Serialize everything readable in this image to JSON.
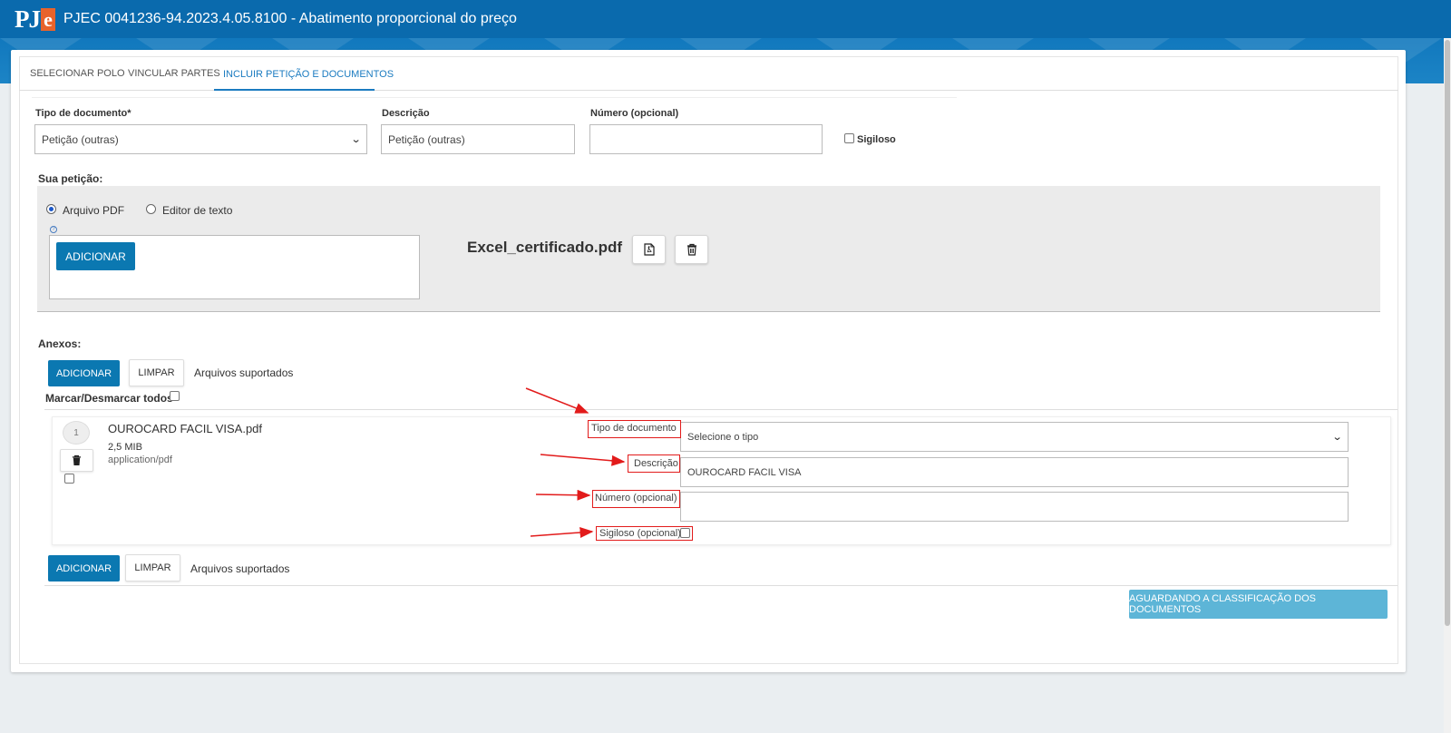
{
  "app": {
    "logo_text": "PJe",
    "title": "PJEC 0041236-94.2023.4.05.8100 - Abatimento proporcional do preço"
  },
  "tabs": [
    {
      "label": "SELECIONAR POLO"
    },
    {
      "label": "VINCULAR PARTES"
    },
    {
      "label": "INCLUIR PETIÇÃO E DOCUMENTOS",
      "active": true
    }
  ],
  "form": {
    "tipo_label": "Tipo de documento*",
    "tipo_value": "Petição (outras)",
    "descricao_label": "Descrição",
    "descricao_value": "Petição (outras)",
    "numero_label": "Número (opcional)",
    "numero_value": "",
    "sigiloso_label": "Sigiloso",
    "sigiloso_checked": false
  },
  "peticao": {
    "heading": "Sua petição:",
    "option_pdf": "Arquivo PDF",
    "option_editor": "Editor de texto",
    "selected_option": "Arquivo PDF",
    "help_icon": "?",
    "add_button": "ADICIONAR",
    "file_name": "Excel_certificado.pdf"
  },
  "anexos": {
    "heading": "Anexos:",
    "add_button": "ADICIONAR",
    "clear_button": "LIMPAR",
    "supported_text": "Arquivos suportados",
    "select_all_label": "Marcar/Desmarcar todos",
    "items": [
      {
        "index": "1",
        "name": "OUROCARD FACIL VISA.pdf",
        "size": "2,5 MIB",
        "mime": "application/pdf",
        "tipo_label": "Tipo de documento",
        "tipo_value": "Selecione o tipo",
        "descricao_label": "Descrição",
        "descricao_value": "OUROCARD FACIL VISA",
        "numero_label": "Número (opcional)",
        "numero_value": "",
        "sigiloso_label": "Sigiloso (opcional)"
      }
    ],
    "bottom_add_button": "ADICIONAR",
    "bottom_clear_button": "LIMPAR",
    "bottom_supported_text": "Arquivos suportados"
  },
  "status_button": "AGUARDANDO A CLASSIFICAÇÃO DOS DOCUMENTOS",
  "colors": {
    "header": "#0a6aad",
    "primary_button": "#0b78b1",
    "status_button": "#5db5d7",
    "annotation": "#e21b1b",
    "active_tab": "#1b7bc0"
  }
}
